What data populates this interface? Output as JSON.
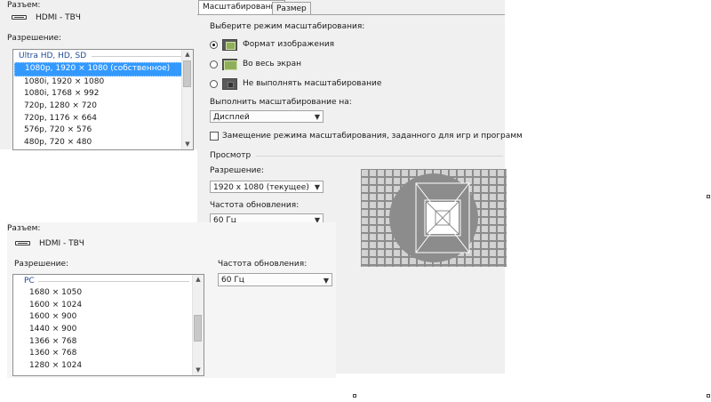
{
  "top_left": {
    "connector_label": "Разъем:",
    "connector_value": "HDMI - ТВЧ",
    "resolution_label": "Разрешение:",
    "list": {
      "group": "Ultra HD, HD, SD",
      "items": [
        "1080p, 1920 × 1080 (собственное)",
        "1080i, 1920 × 1080",
        "1080i, 1768 × 992",
        "720p, 1280 × 720",
        "720p, 1176 × 664",
        "576p, 720 × 576",
        "480p, 720 × 480"
      ],
      "selected_index": 0
    }
  },
  "tabs": [
    "Масштабирование",
    "Размер"
  ],
  "scaling": {
    "choose_mode_label": "Выберите режим масштабирования:",
    "modes": [
      "Формат изображения",
      "Во весь экран",
      "Не выполнять масштабирование"
    ],
    "selected_mode": 0,
    "perform_on_label": "Выполнить масштабирование на:",
    "perform_on_value": "Дисплей",
    "override_label": "Замещение режима масштабирования, заданного для игр и программ",
    "override_checked": false,
    "preview_label": "Просмотр",
    "resolution_label": "Разрешение:",
    "resolution_value": "1920 x 1080 (текущее)",
    "refresh_label": "Частота обновления:",
    "refresh_value": "60 Гц"
  },
  "bottom": {
    "connector_label": "Разъем:",
    "connector_value": "HDMI - ТВЧ",
    "resolution_label": "Разрешение:",
    "refresh_label": "Частота обновления:",
    "refresh_value": "60 Гц",
    "list": {
      "group": "PC",
      "items": [
        "1680 × 1050",
        "1600 × 1024",
        "1600 × 900",
        "1440 × 900",
        "1366 × 768",
        "1360 × 768",
        "1280 × 1024"
      ]
    }
  },
  "colors": {
    "selection": "#3399ff",
    "group_header": "#1e4a96",
    "panel_bg": "#f0f0f0",
    "preview_gray": "#8c8c8c"
  }
}
